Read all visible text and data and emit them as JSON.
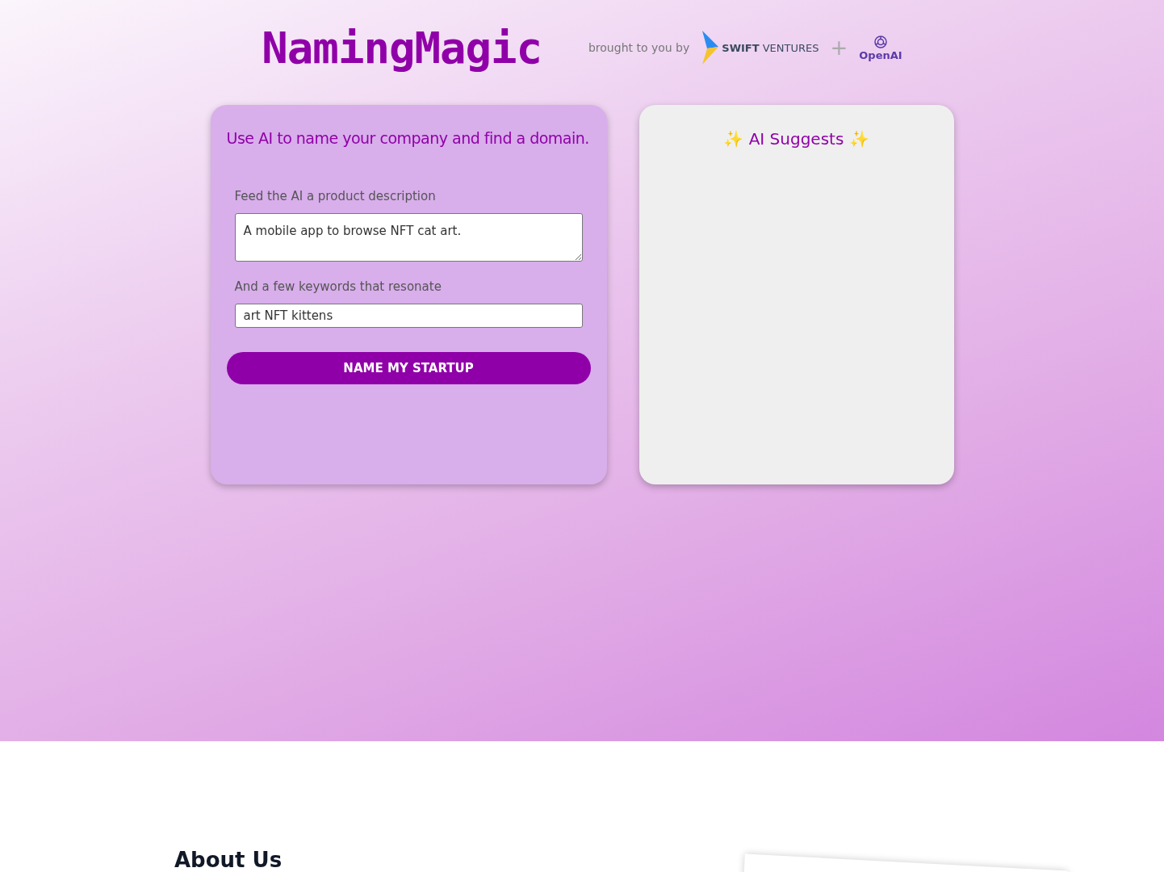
{
  "header": {
    "logo": "NamingMagic",
    "tagline": "brought to you by",
    "partners": [
      {
        "kind": "swift",
        "name": "**SWIFT** VENTURES"
      },
      {
        "kind": "plus",
        "name": "+"
      },
      {
        "kind": "openai",
        "name": "OpenAI"
      }
    ]
  },
  "form_card": {
    "title": "Use AI to name your company and find a domain.",
    "description_label": "Feed the AI a product description",
    "description_value": "A mobile app to browse NFT cat art.",
    "keywords_label": "And a few keywords that resonate",
    "keywords_value": "art NFT kittens",
    "button": "NAME MY STARTUP"
  },
  "results_card": {
    "title": "✨ AI Suggests ✨"
  },
  "about": {
    "heading": "About Us"
  }
}
